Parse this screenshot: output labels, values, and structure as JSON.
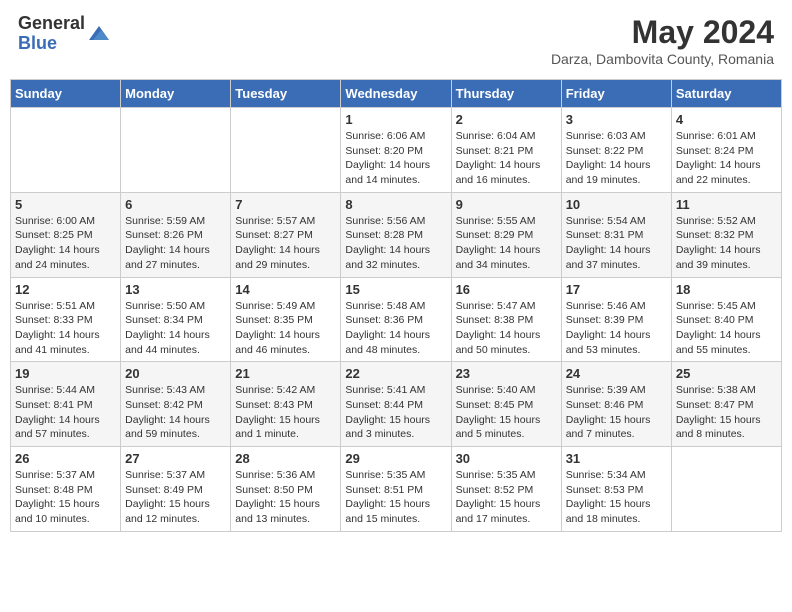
{
  "header": {
    "logo_general": "General",
    "logo_blue": "Blue",
    "month_year": "May 2024",
    "location": "Darza, Dambovita County, Romania"
  },
  "days_of_week": [
    "Sunday",
    "Monday",
    "Tuesday",
    "Wednesday",
    "Thursday",
    "Friday",
    "Saturday"
  ],
  "weeks": [
    [
      {
        "day": "",
        "info": ""
      },
      {
        "day": "",
        "info": ""
      },
      {
        "day": "",
        "info": ""
      },
      {
        "day": "1",
        "info": "Sunrise: 6:06 AM\nSunset: 8:20 PM\nDaylight: 14 hours\nand 14 minutes."
      },
      {
        "day": "2",
        "info": "Sunrise: 6:04 AM\nSunset: 8:21 PM\nDaylight: 14 hours\nand 16 minutes."
      },
      {
        "day": "3",
        "info": "Sunrise: 6:03 AM\nSunset: 8:22 PM\nDaylight: 14 hours\nand 19 minutes."
      },
      {
        "day": "4",
        "info": "Sunrise: 6:01 AM\nSunset: 8:24 PM\nDaylight: 14 hours\nand 22 minutes."
      }
    ],
    [
      {
        "day": "5",
        "info": "Sunrise: 6:00 AM\nSunset: 8:25 PM\nDaylight: 14 hours\nand 24 minutes."
      },
      {
        "day": "6",
        "info": "Sunrise: 5:59 AM\nSunset: 8:26 PM\nDaylight: 14 hours\nand 27 minutes."
      },
      {
        "day": "7",
        "info": "Sunrise: 5:57 AM\nSunset: 8:27 PM\nDaylight: 14 hours\nand 29 minutes."
      },
      {
        "day": "8",
        "info": "Sunrise: 5:56 AM\nSunset: 8:28 PM\nDaylight: 14 hours\nand 32 minutes."
      },
      {
        "day": "9",
        "info": "Sunrise: 5:55 AM\nSunset: 8:29 PM\nDaylight: 14 hours\nand 34 minutes."
      },
      {
        "day": "10",
        "info": "Sunrise: 5:54 AM\nSunset: 8:31 PM\nDaylight: 14 hours\nand 37 minutes."
      },
      {
        "day": "11",
        "info": "Sunrise: 5:52 AM\nSunset: 8:32 PM\nDaylight: 14 hours\nand 39 minutes."
      }
    ],
    [
      {
        "day": "12",
        "info": "Sunrise: 5:51 AM\nSunset: 8:33 PM\nDaylight: 14 hours\nand 41 minutes."
      },
      {
        "day": "13",
        "info": "Sunrise: 5:50 AM\nSunset: 8:34 PM\nDaylight: 14 hours\nand 44 minutes."
      },
      {
        "day": "14",
        "info": "Sunrise: 5:49 AM\nSunset: 8:35 PM\nDaylight: 14 hours\nand 46 minutes."
      },
      {
        "day": "15",
        "info": "Sunrise: 5:48 AM\nSunset: 8:36 PM\nDaylight: 14 hours\nand 48 minutes."
      },
      {
        "day": "16",
        "info": "Sunrise: 5:47 AM\nSunset: 8:38 PM\nDaylight: 14 hours\nand 50 minutes."
      },
      {
        "day": "17",
        "info": "Sunrise: 5:46 AM\nSunset: 8:39 PM\nDaylight: 14 hours\nand 53 minutes."
      },
      {
        "day": "18",
        "info": "Sunrise: 5:45 AM\nSunset: 8:40 PM\nDaylight: 14 hours\nand 55 minutes."
      }
    ],
    [
      {
        "day": "19",
        "info": "Sunrise: 5:44 AM\nSunset: 8:41 PM\nDaylight: 14 hours\nand 57 minutes."
      },
      {
        "day": "20",
        "info": "Sunrise: 5:43 AM\nSunset: 8:42 PM\nDaylight: 14 hours\nand 59 minutes."
      },
      {
        "day": "21",
        "info": "Sunrise: 5:42 AM\nSunset: 8:43 PM\nDaylight: 15 hours\nand 1 minute."
      },
      {
        "day": "22",
        "info": "Sunrise: 5:41 AM\nSunset: 8:44 PM\nDaylight: 15 hours\nand 3 minutes."
      },
      {
        "day": "23",
        "info": "Sunrise: 5:40 AM\nSunset: 8:45 PM\nDaylight: 15 hours\nand 5 minutes."
      },
      {
        "day": "24",
        "info": "Sunrise: 5:39 AM\nSunset: 8:46 PM\nDaylight: 15 hours\nand 7 minutes."
      },
      {
        "day": "25",
        "info": "Sunrise: 5:38 AM\nSunset: 8:47 PM\nDaylight: 15 hours\nand 8 minutes."
      }
    ],
    [
      {
        "day": "26",
        "info": "Sunrise: 5:37 AM\nSunset: 8:48 PM\nDaylight: 15 hours\nand 10 minutes."
      },
      {
        "day": "27",
        "info": "Sunrise: 5:37 AM\nSunset: 8:49 PM\nDaylight: 15 hours\nand 12 minutes."
      },
      {
        "day": "28",
        "info": "Sunrise: 5:36 AM\nSunset: 8:50 PM\nDaylight: 15 hours\nand 13 minutes."
      },
      {
        "day": "29",
        "info": "Sunrise: 5:35 AM\nSunset: 8:51 PM\nDaylight: 15 hours\nand 15 minutes."
      },
      {
        "day": "30",
        "info": "Sunrise: 5:35 AM\nSunset: 8:52 PM\nDaylight: 15 hours\nand 17 minutes."
      },
      {
        "day": "31",
        "info": "Sunrise: 5:34 AM\nSunset: 8:53 PM\nDaylight: 15 hours\nand 18 minutes."
      },
      {
        "day": "",
        "info": ""
      }
    ]
  ]
}
